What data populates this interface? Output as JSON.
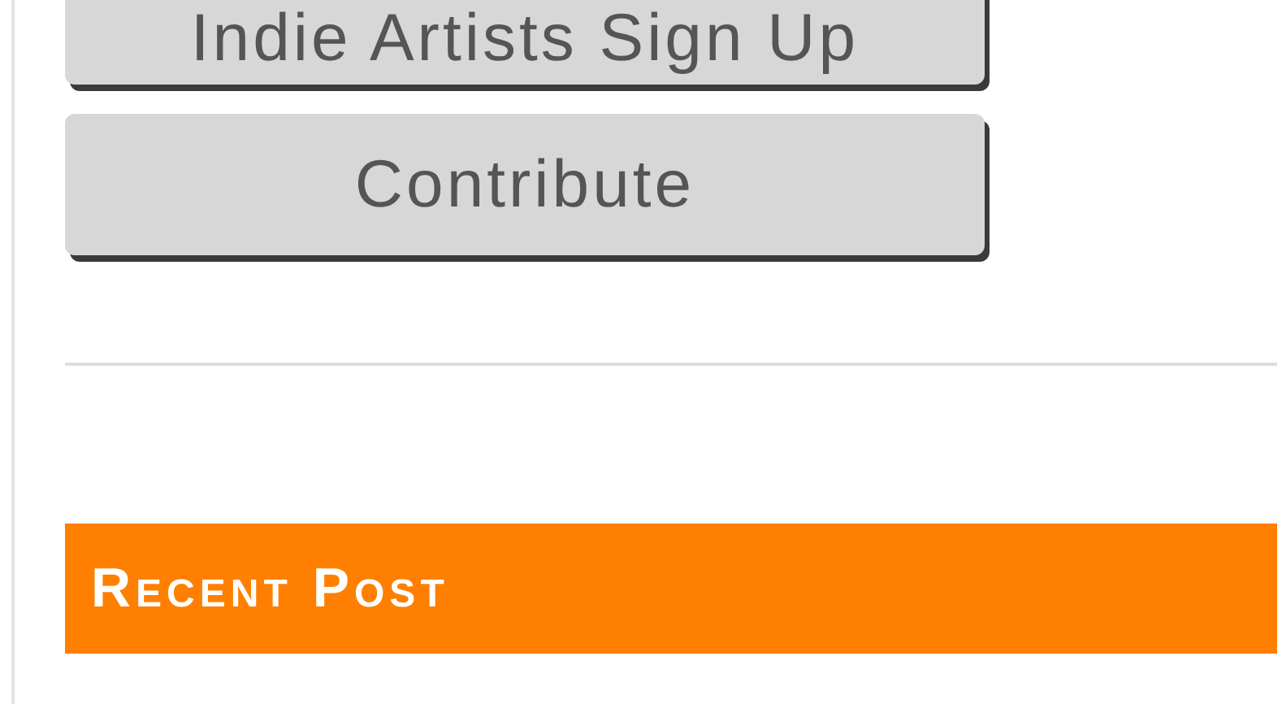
{
  "buttons": [
    {
      "label": "Indie Artists Sign Up"
    },
    {
      "label": "Contribute"
    }
  ],
  "recent_post": {
    "title": "Recent Post"
  }
}
